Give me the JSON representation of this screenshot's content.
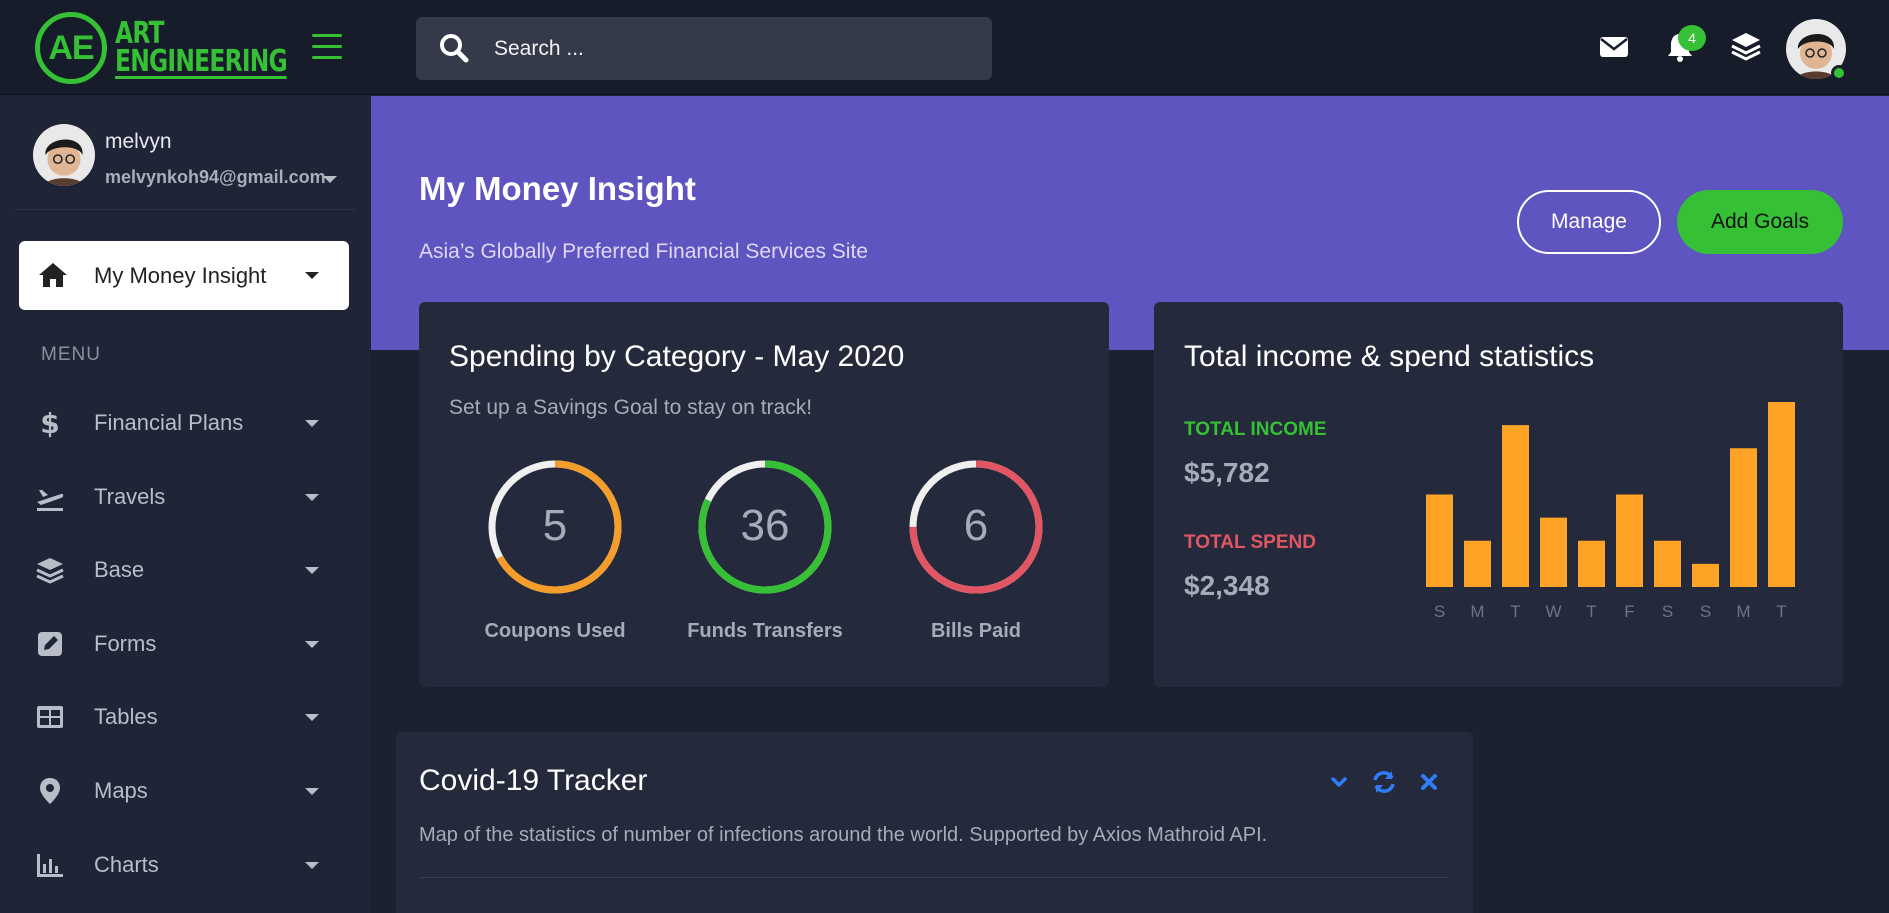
{
  "brand": {
    "mark": "AE",
    "line1": "ART",
    "line2": "ENGINEERING"
  },
  "search": {
    "placeholder": "Search ..."
  },
  "topbar": {
    "notification_count": "4"
  },
  "profile": {
    "name": "melvyn",
    "email": "melvynkoh94@gmail.com"
  },
  "sidebar": {
    "active_label": "My Money Insight",
    "menu_heading": "MENU",
    "items": [
      {
        "label": "Financial Plans",
        "icon": "dollar-icon"
      },
      {
        "label": "Travels",
        "icon": "plane-icon"
      },
      {
        "label": "Base",
        "icon": "layers-icon"
      },
      {
        "label": "Forms",
        "icon": "edit-icon"
      },
      {
        "label": "Tables",
        "icon": "table-icon"
      },
      {
        "label": "Maps",
        "icon": "map-pin-icon"
      },
      {
        "label": "Charts",
        "icon": "bar-chart-icon"
      }
    ]
  },
  "hero": {
    "title": "My Money Insight",
    "subtitle": "Asia’s Globally Preferred Financial Services Site",
    "manage_label": "Manage",
    "add_goals_label": "Add Goals"
  },
  "spending": {
    "title": "Spending by Category - May 2020",
    "subtitle": "Set up a Savings Goal to stay on track!",
    "stats": [
      {
        "value": "5",
        "label": "Coupons Used",
        "color": "#f59d2a",
        "fill": 0.67
      },
      {
        "value": "36",
        "label": "Funds Transfers",
        "color": "#35c035",
        "fill": 0.82
      },
      {
        "value": "6",
        "label": "Bills Paid",
        "color": "#e25663",
        "fill": 0.75
      }
    ]
  },
  "income": {
    "title": "Total income & spend statistics",
    "income_label": "TOTAL INCOME",
    "income_value": "$5,782",
    "spend_label": "TOTAL SPEND",
    "spend_value": "$2,348"
  },
  "chart_data": {
    "type": "bar",
    "categories": [
      "S",
      "M",
      "T",
      "W",
      "T",
      "F",
      "S",
      "S",
      "M",
      "T"
    ],
    "values": [
      4,
      2,
      7,
      3,
      2,
      4,
      2,
      1,
      6,
      8
    ],
    "ylim": [
      0,
      8
    ],
    "color": "#ffa326",
    "grid": false
  },
  "covid": {
    "title": "Covid-19 Tracker",
    "subtitle": "Map of the statistics of number of infections around the world. Supported by Axios Mathroid API."
  },
  "colors": {
    "accent": "#35c035",
    "hero": "#5e55c0",
    "danger": "#e25663",
    "warning": "#f59d2a",
    "link": "#2e7cf6"
  }
}
